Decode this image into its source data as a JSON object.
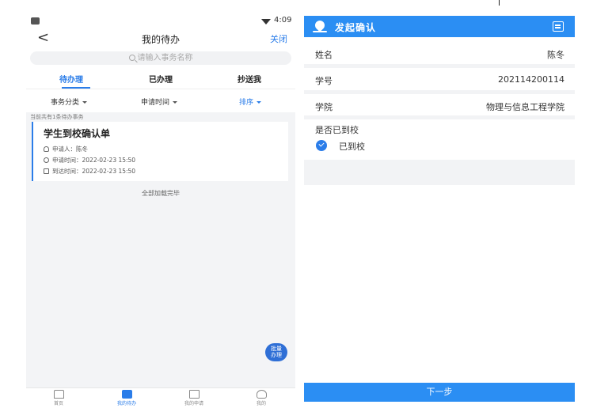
{
  "left": {
    "status_time": "4:09",
    "nav": {
      "back": "<",
      "title": "我的待办",
      "close": "关闭"
    },
    "search": {
      "placeholder": "请输入事务名称"
    },
    "tabs": [
      {
        "label": "待办理",
        "active": true
      },
      {
        "label": "已办理",
        "active": false
      },
      {
        "label": "抄送我",
        "active": false
      }
    ],
    "filters": [
      {
        "label": "事务分类"
      },
      {
        "label": "申请时间"
      },
      {
        "label": "排序"
      }
    ],
    "count_text": "当前共有1条待办事务",
    "card": {
      "title": "学生到校确认单",
      "applicant": "申请人：陈冬",
      "apply_time": "申请时间：2022-02-23 15:50",
      "arrive_time": "到达时间：2022-02-23 15:50"
    },
    "loaded_text": "全部加载完毕",
    "batch_button": {
      "line1": "批量",
      "line2": "办理"
    },
    "tabbar": [
      {
        "label": "首页",
        "icon": "home-icon"
      },
      {
        "label": "我的待办",
        "icon": "todo-icon",
        "active": true
      },
      {
        "label": "我的申请",
        "icon": "application-icon"
      },
      {
        "label": "我的",
        "icon": "user-icon"
      }
    ]
  },
  "right": {
    "header_title": "发起确认",
    "fields": [
      {
        "label": "姓名",
        "value": "陈冬"
      },
      {
        "label": "学号",
        "value": "202114200114"
      },
      {
        "label": "学院",
        "value": "物理与信息工程学院"
      }
    ],
    "question": "是否已到校",
    "option": "已到校",
    "next_button": "下一步"
  },
  "colors": {
    "accent": "#2b7de9",
    "header_blue": "#2b8ef3"
  }
}
